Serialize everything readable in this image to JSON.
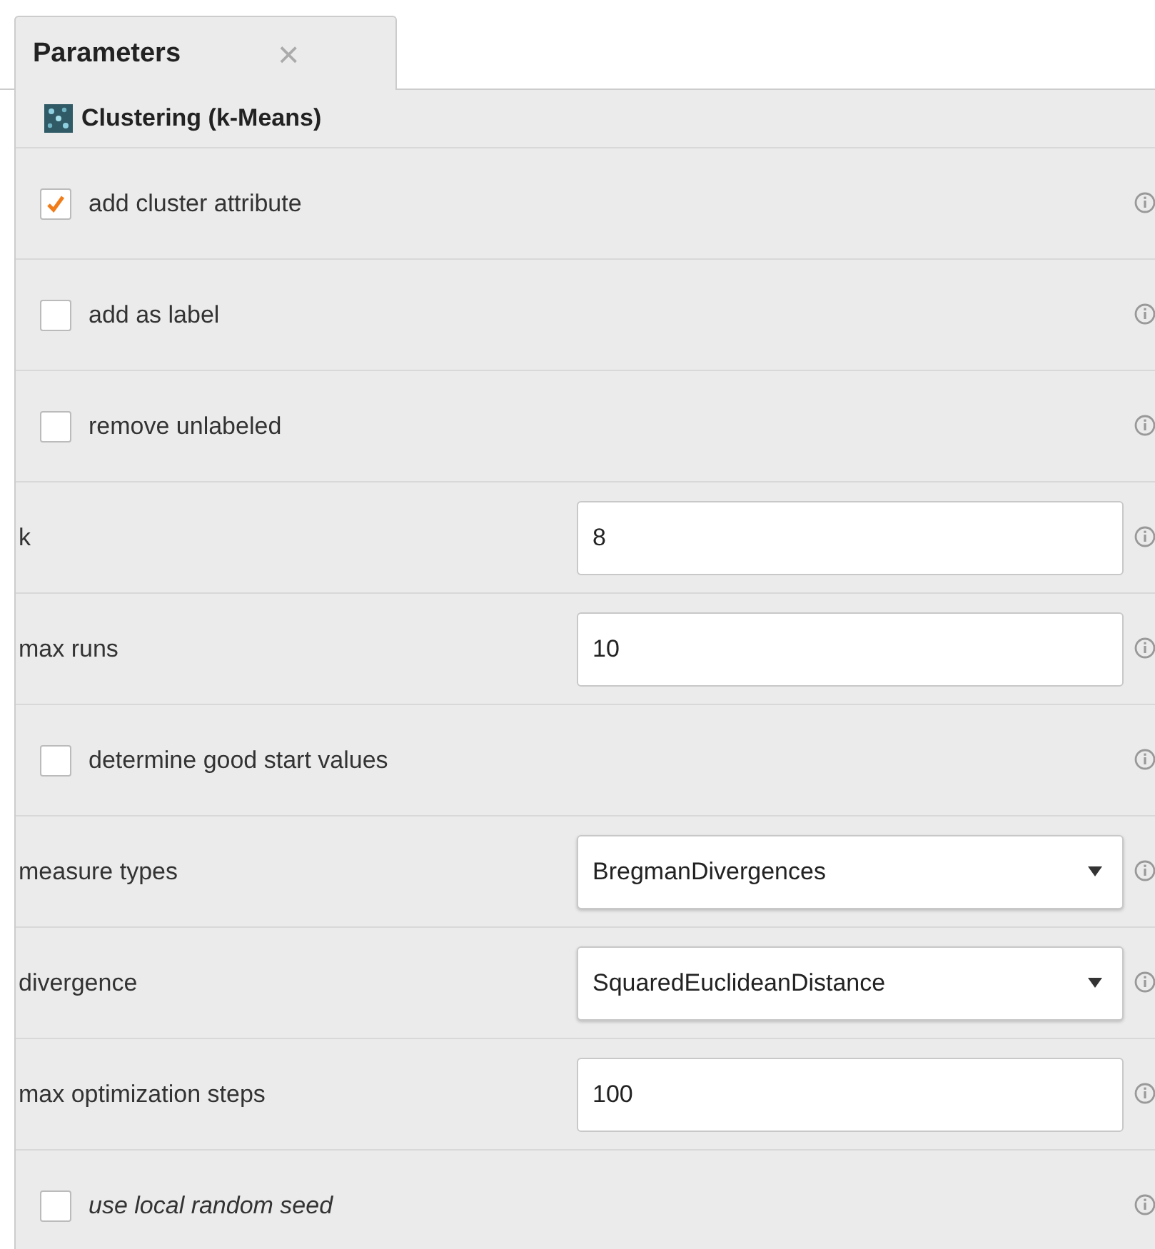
{
  "tab": {
    "label": "Parameters",
    "close": "×",
    "selected": true
  },
  "operator": {
    "title": "Clustering (k-Means)"
  },
  "params": [
    {
      "kind": "checkbox",
      "label": "add cluster attribute",
      "checked": true,
      "italic": false
    },
    {
      "kind": "checkbox",
      "label": "add as label",
      "checked": false,
      "italic": false
    },
    {
      "kind": "checkbox",
      "label": "remove unlabeled",
      "checked": false,
      "italic": false
    },
    {
      "kind": "number",
      "label": "k",
      "value": "8",
      "italic": false
    },
    {
      "kind": "number",
      "label": "max runs",
      "value": "10",
      "italic": false
    },
    {
      "kind": "checkbox",
      "label": "determine good start values",
      "checked": false,
      "italic": false
    },
    {
      "kind": "select",
      "label": "measure types",
      "value": "BregmanDivergences",
      "italic": false
    },
    {
      "kind": "select",
      "label": "divergence",
      "value": "SquaredEuclideanDistance",
      "italic": false
    },
    {
      "kind": "number",
      "label": "max optimization steps",
      "value": "100",
      "italic": false
    },
    {
      "kind": "checkbox",
      "label": "use local random seed",
      "checked": false,
      "italic": true
    }
  ]
}
